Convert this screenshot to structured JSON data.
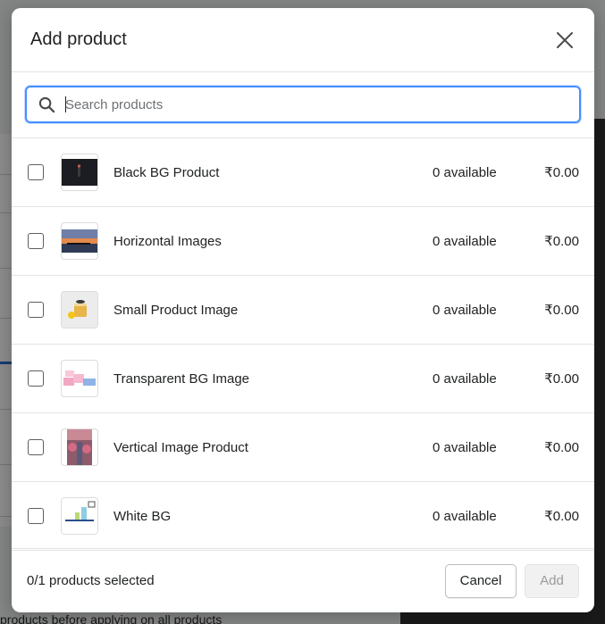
{
  "background": {
    "bottom_text": "products before applying on all products"
  },
  "modal": {
    "title": "Add product",
    "close_icon": "close-icon"
  },
  "search": {
    "placeholder": "Search products",
    "value": "",
    "icon": "search-icon"
  },
  "products": [
    {
      "name": "Black BG Product",
      "availability": "0 available",
      "price": "₹0.00",
      "selected": false
    },
    {
      "name": "Horizontal Images",
      "availability": "0 available",
      "price": "₹0.00",
      "selected": false
    },
    {
      "name": "Small Product Image",
      "availability": "0 available",
      "price": "₹0.00",
      "selected": false
    },
    {
      "name": "Transparent BG Image",
      "availability": "0 available",
      "price": "₹0.00",
      "selected": false
    },
    {
      "name": "Vertical Image Product",
      "availability": "0 available",
      "price": "₹0.00",
      "selected": false
    },
    {
      "name": "White BG",
      "availability": "0 available",
      "price": "₹0.00",
      "selected": false
    }
  ],
  "footer": {
    "selected_count": "0/1 products selected",
    "cancel_label": "Cancel",
    "add_label": "Add"
  },
  "colors": {
    "focus_blue": "#458fff",
    "overlay": "rgba(0,0,0,0.45)",
    "disabled_button_text": "#9a9a9a"
  }
}
